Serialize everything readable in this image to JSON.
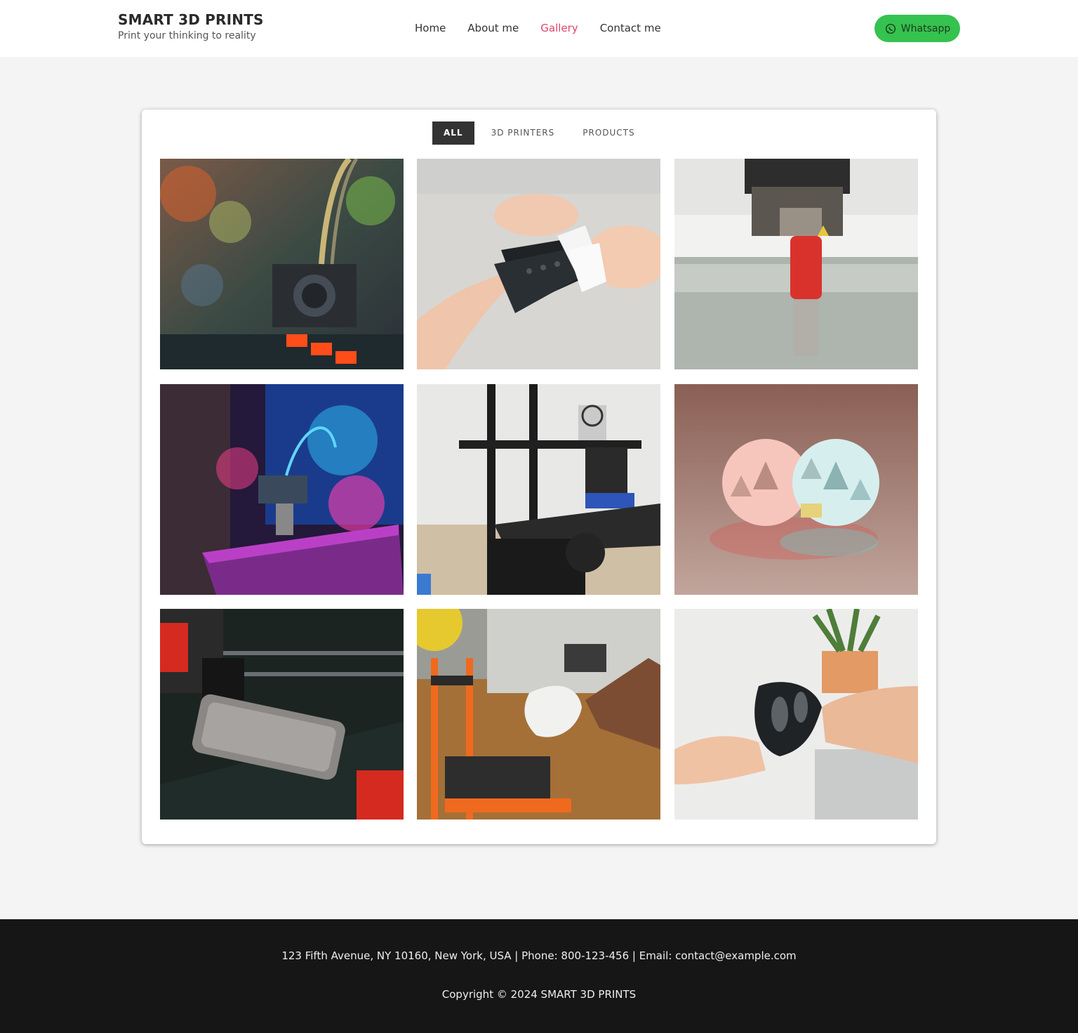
{
  "brand": {
    "title": "SMART 3D PRINTS",
    "tagline": "Print your thinking to reality"
  },
  "nav": {
    "items": [
      {
        "label": "Home",
        "active": false
      },
      {
        "label": "About me",
        "active": false
      },
      {
        "label": "Gallery",
        "active": true
      },
      {
        "label": "Contact me",
        "active": false
      }
    ],
    "active_color": "#e0446c"
  },
  "whatsapp": {
    "label": "Whatsapp",
    "icon": "whatsapp-icon",
    "color": "#35c24f"
  },
  "gallery": {
    "filters": [
      {
        "label": "ALL",
        "active": true
      },
      {
        "label": "3D PRINTERS",
        "active": false
      },
      {
        "label": "PRODUCTS",
        "active": false
      }
    ],
    "photo_count": 9
  },
  "footer": {
    "contact": "123 Fifth Avenue, NY 10160, New York, USA | Phone: 800-123-456 | Email: contact@example.com",
    "copyright": "Copyright © 2024 SMART 3D PRINTS"
  }
}
